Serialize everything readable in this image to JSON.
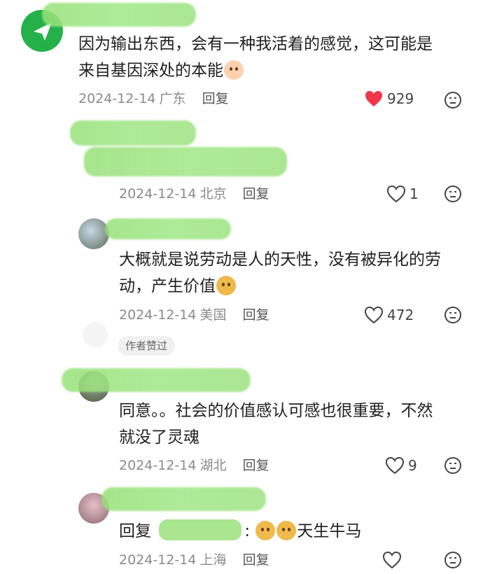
{
  "comments": [
    {
      "text_line1": "因为输出东西，会有一种我活着的感觉，这可能是",
      "text_line2": "来自基因深处的本能",
      "date": "2024-12-14",
      "location": "广东",
      "reply_label": "回复",
      "likes": "929",
      "liked": true
    },
    {
      "date": "2024-12-14",
      "location": "北京",
      "reply_label": "回复",
      "likes": "1"
    },
    {
      "text_line1": "大概就是说劳动是人的天性，没有被异化的劳",
      "text_line2": "动，产生价值",
      "date": "2024-12-14",
      "location": "美国",
      "reply_label": "回复",
      "likes": "472",
      "badge": "作者赞过"
    },
    {
      "text_line1": "同意。。社会的价值感认可感也很重要，不然",
      "text_line2": "就没了灵魂",
      "date": "2024-12-14",
      "location": "湖北",
      "reply_label": "回复",
      "likes": "9"
    },
    {
      "reply_prefix": "回复",
      "reply_colon": ":",
      "text": "天生牛马",
      "date": "2024-12-14",
      "location": "上海",
      "reply_label": "回复",
      "likes": ""
    }
  ],
  "colors": {
    "heart_liked": "#f0364a",
    "redaction": "#9be07c",
    "avatar_green": "#25b14a"
  },
  "icons": [
    "send-icon",
    "heart-icon",
    "dislike-face-icon",
    "emoji-face"
  ]
}
